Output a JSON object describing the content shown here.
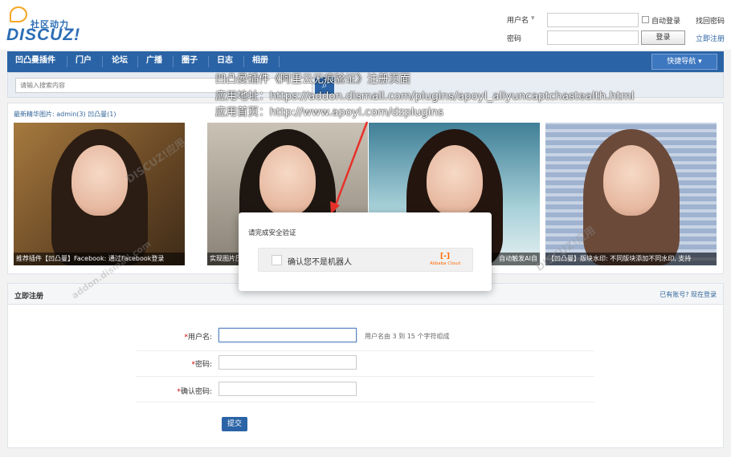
{
  "logo": {
    "tagline": "社区动力",
    "wordmark": "DISCUZ!"
  },
  "login": {
    "username_label": "用户名",
    "password_label": "密码",
    "auto_login": "自动登录",
    "login_button": "登录",
    "forgot_password": "找回密码",
    "register_link": "立即注册"
  },
  "nav": {
    "items": [
      "凹凸曼插件",
      "门户",
      "论坛",
      "广播",
      "圈子",
      "日志",
      "相册"
    ],
    "quick_nav": "快捷导航"
  },
  "search": {
    "placeholder": "请输入搜索内容"
  },
  "gallery": {
    "title": "最新精华图片: admin(3) 凹凸曼(1)",
    "captions": [
      "推荐插件【凹凸曼】Facebook: 通过Facebook登录",
      "实现图片压缩",
      "自动触发AI自",
      "【凹凸曼】版块水印: 不同版块添加不同水印, 支持"
    ]
  },
  "overlay_text": {
    "line1": "凹凸曼插件《阿里云无痕验证》注册页面",
    "line2": "应用地址：https://addon.dismall.com/plugins/apoyl_aliyuncaptchastealth.html",
    "line3": "应用首页：http://www.apoyl.com/dzplugins"
  },
  "modal": {
    "title": "请完成安全验证",
    "checkbox_label": "确认您不是机器人",
    "brand": "Alibaba Cloud"
  },
  "register": {
    "title": "立即注册",
    "login_link": "已有账号? 现在登录",
    "username_label": "用户名:",
    "username_hint": "用户名由 3 到 15 个字符组成",
    "password_label": "密码:",
    "confirm_label": "确认密码:",
    "submit": "提交"
  },
  "watermark": {
    "brand": "DISCUZ!应用",
    "site": "addon.dismall.com"
  },
  "colors": {
    "nav_bg": "#2b64a6",
    "accent_orange": "#ff6a00",
    "required": "#cc0000"
  }
}
